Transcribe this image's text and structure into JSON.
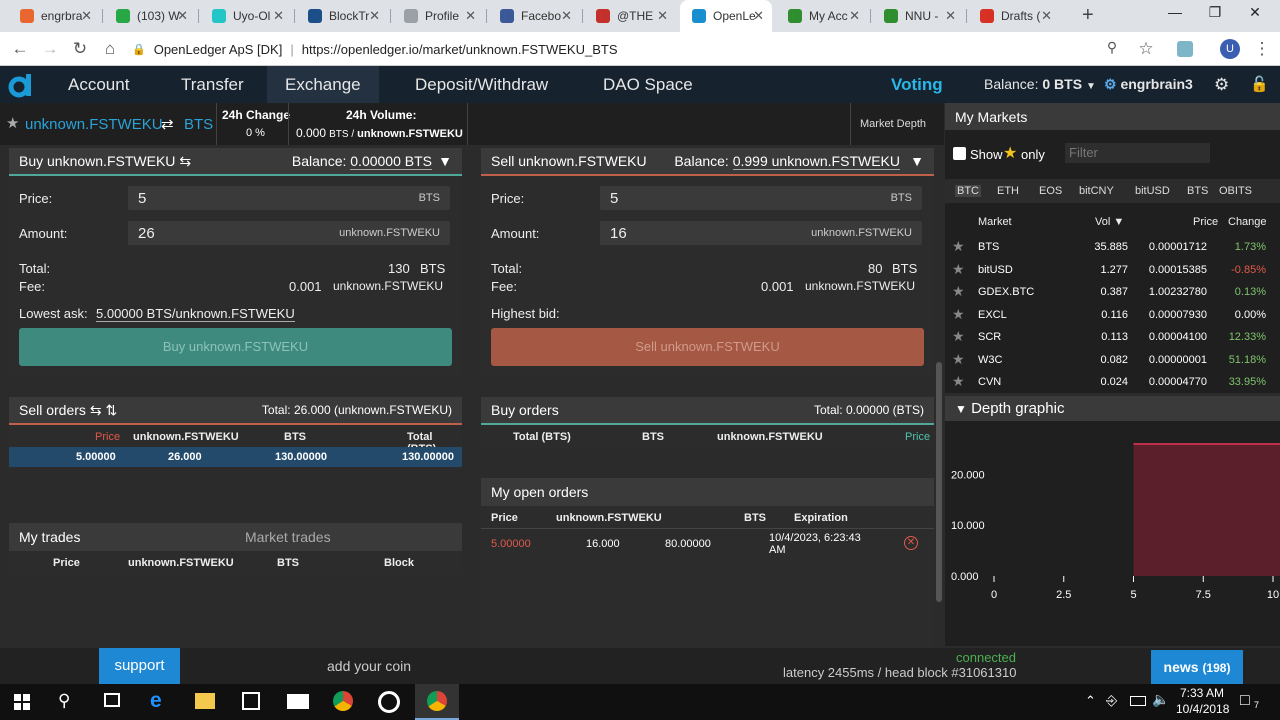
{
  "browser": {
    "tabs": [
      {
        "label": "engrbra",
        "color": "#e8672e"
      },
      {
        "label": "(103) W",
        "color": "#28a745"
      },
      {
        "label": "Uyo-Ol",
        "color": "#22c6c6"
      },
      {
        "label": "BlockTr",
        "color": "#1b4f8a"
      },
      {
        "label": "Profile",
        "color": "#9aa0a6"
      },
      {
        "label": "Facebo",
        "color": "#3b5998"
      },
      {
        "label": "@THE",
        "color": "#c4302b"
      },
      {
        "label": "OpenLe",
        "color": "#1a8fd0"
      },
      {
        "label": "My Acc",
        "color": "#2f8f2f"
      },
      {
        "label": "NNU -",
        "color": "#2f8f2f"
      },
      {
        "label": "Drafts (",
        "color": "#d93025"
      }
    ],
    "url_origin": "OpenLedger ApS [DK]",
    "url": "https://openledger.io/market/unknown.FSTWEKU_BTS",
    "profile_initial": "U"
  },
  "nav": {
    "items": [
      "Account",
      "Transfer",
      "Exchange",
      "Deposit/Withdraw",
      "DAO Space"
    ],
    "voting": "Voting",
    "balance": "Balance: ",
    "balance_val": "0 BTS",
    "user": "engrbrain3"
  },
  "pair": {
    "quote": "unknown.FSTWEKU",
    "base": "BTS",
    "change_label": "24h Change",
    "change_val": "0 %",
    "volume_label": "24h Volume:",
    "volume_val1": "0.000",
    "volume_unit1": "BTS /",
    "volume_unit2": "unknown.FSTWEKU",
    "market_depth": "Market Depth"
  },
  "buy": {
    "title": "Buy unknown.FSTWEKU",
    "balance_label": "Balance:",
    "balance_val": "0.00000 BTS",
    "price_label": "Price:",
    "price": "5",
    "price_unit": "BTS",
    "amount_label": "Amount:",
    "amount": "26",
    "amount_unit": "unknown.FSTWEKU",
    "total_label": "Total:",
    "total": "130",
    "total_unit": "BTS",
    "fee_label": "Fee:",
    "fee": "0.001",
    "fee_unit": "unknown.FSTWEKU",
    "lowest_label": "Lowest ask:",
    "lowest_val": "5.00000 BTS/unknown.FSTWEKU",
    "button": "Buy unknown.FSTWEKU"
  },
  "sell": {
    "title": "Sell unknown.FSTWEKU",
    "balance_label": "Balance:",
    "balance_val": "0.999 unknown.FSTWEKU",
    "price_label": "Price:",
    "price": "5",
    "price_unit": "BTS",
    "amount_label": "Amount:",
    "amount": "16",
    "amount_unit": "unknown.FSTWEKU",
    "total_label": "Total:",
    "total": "80",
    "total_unit": "BTS",
    "fee_label": "Fee:",
    "fee": "0.001",
    "fee_unit": "unknown.FSTWEKU",
    "highest_label": "Highest bid:",
    "button": "Sell unknown.FSTWEKU"
  },
  "sell_orders": {
    "title": "Sell orders",
    "total": "Total: 26.000 (unknown.FSTWEKU)",
    "headers": [
      "Price",
      "unknown.FSTWEKU",
      "BTS",
      "Total (BTS)"
    ],
    "row": [
      "5.00000",
      "26.000",
      "130.00000",
      "130.00000"
    ]
  },
  "buy_orders": {
    "title": "Buy orders",
    "total": "Total: 0.00000 (BTS)",
    "headers": [
      "Total (BTS)",
      "BTS",
      "unknown.FSTWEKU",
      "Price"
    ]
  },
  "open_orders": {
    "title": "My open orders",
    "headers": [
      "Price",
      "unknown.FSTWEKU",
      "BTS",
      "Expiration"
    ],
    "row": [
      "5.00000",
      "16.000",
      "80.00000",
      "10/4/2023, 6:23:43",
      "AM"
    ]
  },
  "trades": {
    "tab_mine": "My trades",
    "tab_market": "Market trades",
    "headers": [
      "Price",
      "unknown.FSTWEKU",
      "BTS",
      "Block"
    ]
  },
  "markets": {
    "title": "My Markets",
    "show": "Show",
    "only": "only",
    "filter": "Filter",
    "tabs": [
      "BTC",
      "ETH",
      "EOS",
      "bitCNY",
      "bitUSD",
      "BTS",
      "OBITS"
    ],
    "headers": [
      "Market",
      "Vol",
      "Price",
      "Change"
    ],
    "rows": [
      {
        "name": "BTS",
        "vol": "35.885",
        "price": "0.00001712",
        "change": "1.73%",
        "color": "#7ec46e"
      },
      {
        "name": "bitUSD",
        "vol": "1.277",
        "price": "0.00015385",
        "change": "-0.85%",
        "color": "#e05a4a"
      },
      {
        "name": "GDEX.BTC",
        "vol": "0.387",
        "price": "1.00232780",
        "change": "0.13%",
        "color": "#7ec46e"
      },
      {
        "name": "EXCL",
        "vol": "0.116",
        "price": "0.00007930",
        "change": "0.00%",
        "color": "#ffffff"
      },
      {
        "name": "SCR",
        "vol": "0.113",
        "price": "0.00004100",
        "change": "12.33%",
        "color": "#7ec46e"
      },
      {
        "name": "W3C",
        "vol": "0.082",
        "price": "0.00000001",
        "change": "51.18%",
        "color": "#7ec46e"
      },
      {
        "name": "CVN",
        "vol": "0.024",
        "price": "0.00004770",
        "change": "33.95%",
        "color": "#7ec46e"
      }
    ]
  },
  "depth": {
    "title": "Depth graphic",
    "y_ticks": [
      "20.000",
      "10.000",
      "0.000"
    ],
    "x_ticks": [
      "0",
      "2.5",
      "5",
      "7.5",
      "10"
    ]
  },
  "chart_data": {
    "type": "area",
    "title": "Depth graphic",
    "x_ticks": [
      0,
      2.5,
      5,
      7.5,
      10
    ],
    "y_ticks": [
      0,
      10,
      20
    ],
    "series": [
      {
        "values": [
          [
            5,
            26
          ],
          [
            10,
            26
          ]
        ]
      }
    ],
    "xlim": [
      0,
      10
    ],
    "ylim": [
      0,
      26
    ]
  },
  "footer": {
    "support": "support",
    "addcoin": "add your coin",
    "connected": "connected",
    "latency": "latency 2455ms / head block #31061310",
    "news": "news",
    "news_count": "(198)"
  },
  "taskbar": {
    "time": "7:33 AM",
    "date": "10/4/2018",
    "notif": "7"
  }
}
